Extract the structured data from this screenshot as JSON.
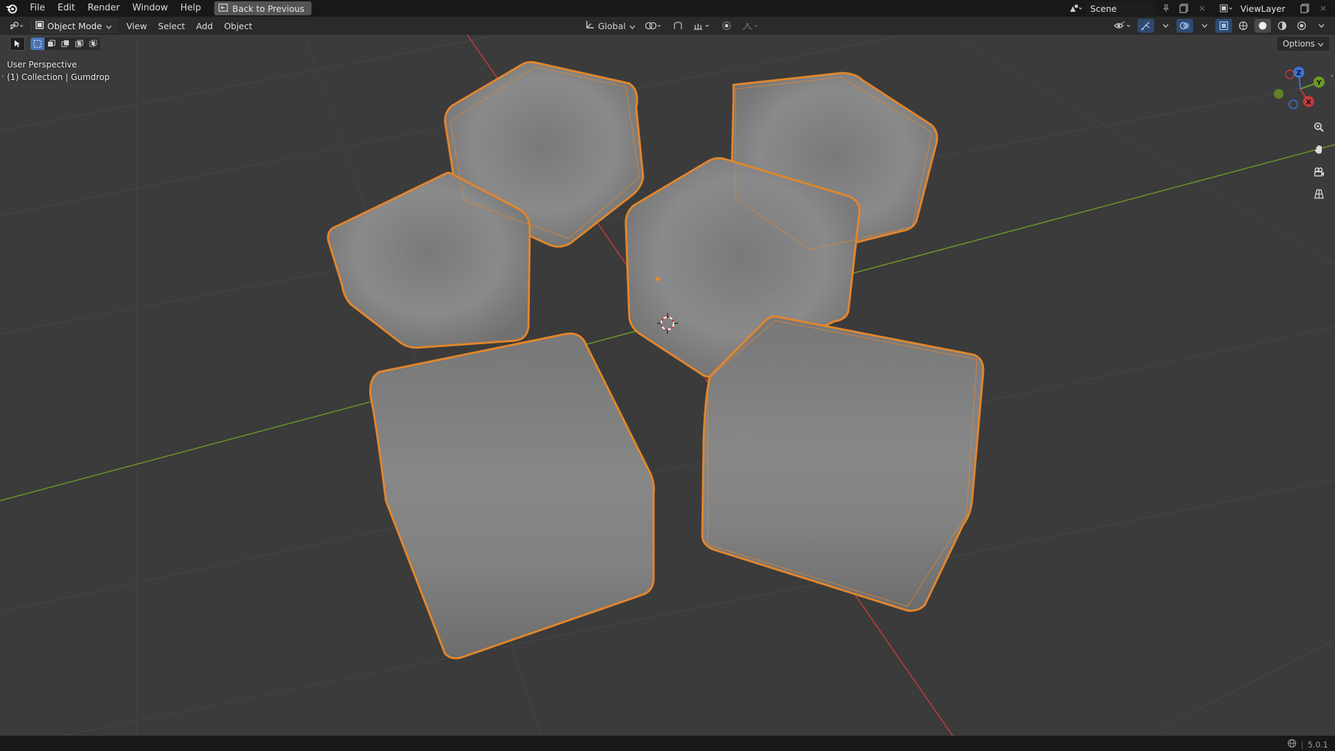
{
  "topbar": {
    "menus": [
      "File",
      "Edit",
      "Render",
      "Window",
      "Help"
    ],
    "back_label": "Back to Previous",
    "scene_name": "Scene",
    "view_layer_name": "ViewLayer"
  },
  "header": {
    "mode_label": "Object Mode",
    "menus": [
      "View",
      "Select",
      "Add",
      "Object"
    ],
    "transform_orientation": "Global",
    "options_label": "Options"
  },
  "viewport": {
    "perspective_label": "User Perspective",
    "collection_label": "(1) Collection | Gumdrop",
    "gizmo_axes": [
      "Z",
      "Y",
      "X"
    ]
  },
  "colors": {
    "selection_outline": "#e8892c",
    "x_axis": "#c23a3a",
    "y_axis": "#6c9a24",
    "z_axis": "#3a72d8",
    "object_fill": "#8a8a8a"
  },
  "status": {
    "version": "5.0.1"
  }
}
